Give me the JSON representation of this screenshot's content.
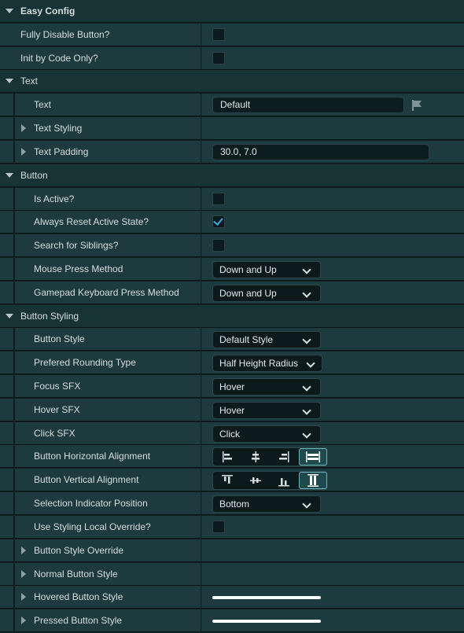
{
  "sections": {
    "easy_config": "Easy Config",
    "text": "Text",
    "button": "Button",
    "button_styling": "Button Styling"
  },
  "props": {
    "fully_disable": {
      "label": "Fully Disable Button?",
      "checked": false
    },
    "init_by_code": {
      "label": "Init by Code Only?",
      "checked": false
    },
    "text": {
      "label": "Text",
      "value": "Default"
    },
    "text_styling": {
      "label": "Text Styling"
    },
    "text_padding": {
      "label": "Text Padding",
      "value": "30.0, 7.0"
    },
    "is_active": {
      "label": "Is Active?",
      "checked": false
    },
    "always_reset": {
      "label": "Always Reset Active State?",
      "checked": true
    },
    "search_siblings": {
      "label": "Search for Siblings?",
      "checked": false
    },
    "mouse_press": {
      "label": "Mouse Press Method",
      "value": "Down and Up"
    },
    "gamepad_press": {
      "label": "Gamepad Keyboard Press Method",
      "value": "Down and Up"
    },
    "button_style": {
      "label": "Button Style",
      "value": "Default Style"
    },
    "rounding_type": {
      "label": "Prefered Rounding Type",
      "value": "Half Height Radius"
    },
    "focus_sfx": {
      "label": "Focus SFX",
      "value": "Hover"
    },
    "hover_sfx": {
      "label": "Hover SFX",
      "value": "Hover"
    },
    "click_sfx": {
      "label": "Click SFX",
      "value": "Click"
    },
    "h_align": {
      "label": "Button Horizontal Alignment",
      "selected": "fill"
    },
    "v_align": {
      "label": "Button Vertical Alignment",
      "selected": "fill"
    },
    "sel_indicator": {
      "label": "Selection Indicator Position",
      "value": "Bottom"
    },
    "use_override": {
      "label": "Use Styling Local Override?",
      "checked": false
    },
    "style_override": {
      "label": "Button Style Override"
    },
    "normal_style": {
      "label": "Normal Button Style"
    },
    "hovered_style": {
      "label": "Hovered Button Style"
    },
    "pressed_style": {
      "label": "Pressed Button Style"
    }
  },
  "colors": {
    "accent_check": "#3fa9e0",
    "category_bg": "#173336",
    "row_bg": "#1d3a3e"
  }
}
